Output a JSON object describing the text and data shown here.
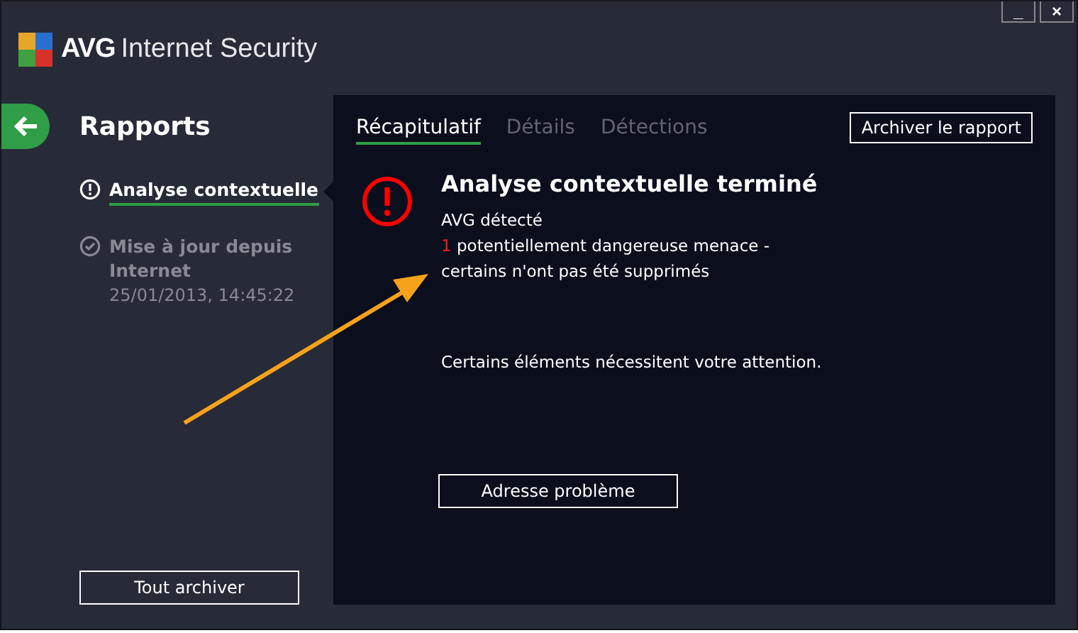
{
  "window": {
    "brand": "AVG",
    "product": "Internet Security",
    "minimize": "_",
    "close": "×"
  },
  "sidebar": {
    "title": "Rapports",
    "items": [
      {
        "kind": "alert",
        "label": "Analyse contextuelle",
        "selected": true
      },
      {
        "kind": "check",
        "label": "Mise à jour depuis Internet",
        "date": "25/01/2013, 14:45:22",
        "selected": false
      }
    ],
    "button": "Tout archiver"
  },
  "tabs": [
    {
      "label": "Récapitulatif",
      "selected": true
    },
    {
      "label": "Détails",
      "selected": false
    },
    {
      "label": "Détections",
      "selected": false
    }
  ],
  "archive_button": "Archiver le rapport",
  "result": {
    "title": "Analyse contextuelle terminé",
    "line": "AVG détecté",
    "count": "1",
    "threat": "potentiellement dangereuse menace -",
    "note": "certains n'ont pas été supprimés",
    "attention": "Certains éléments nécessitent votre attention.",
    "button": "Adresse problème"
  }
}
